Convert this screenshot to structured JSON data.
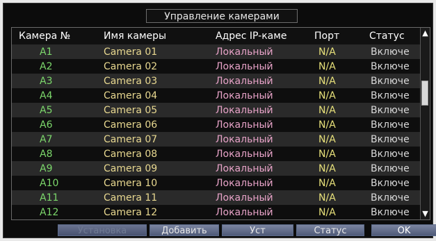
{
  "window": {
    "title": "Управление камерами"
  },
  "table": {
    "headers": {
      "num": "Камера №",
      "name": "Имя камеры",
      "ip": "Адрес IP-каме",
      "port": "Порт",
      "status": "Статус"
    },
    "rows": [
      {
        "num": "A1",
        "name": "Camera 01",
        "ip": "Локальный",
        "port": "N/A",
        "status": "Включе"
      },
      {
        "num": "A2",
        "name": "Camera 02",
        "ip": "Локальный",
        "port": "N/A",
        "status": "Включе"
      },
      {
        "num": "A3",
        "name": "Camera 03",
        "ip": "Локальный",
        "port": "N/A",
        "status": "Включе"
      },
      {
        "num": "A4",
        "name": "Camera 04",
        "ip": "Локальный",
        "port": "N/A",
        "status": "Включе"
      },
      {
        "num": "A5",
        "name": "Camera 05",
        "ip": "Локальный",
        "port": "N/A",
        "status": "Включе"
      },
      {
        "num": "A6",
        "name": "Camera 06",
        "ip": "Локальный",
        "port": "N/A",
        "status": "Включе"
      },
      {
        "num": "A7",
        "name": "Camera 07",
        "ip": "Локальный",
        "port": "N/A",
        "status": "Включе"
      },
      {
        "num": "A8",
        "name": "Camera 08",
        "ip": "Локальный",
        "port": "N/A",
        "status": "Включе"
      },
      {
        "num": "A9",
        "name": "Camera 09",
        "ip": "Локальный",
        "port": "N/A",
        "status": "Включе"
      },
      {
        "num": "A10",
        "name": "Camera 10",
        "ip": "Локальный",
        "port": "N/A",
        "status": "Включе"
      },
      {
        "num": "A11",
        "name": "Camera 11",
        "ip": "Локальный",
        "port": "N/A",
        "status": "Включе"
      },
      {
        "num": "A12",
        "name": "Camera 12",
        "ip": "Локальный",
        "port": "N/A",
        "status": "Включе"
      }
    ]
  },
  "scroll": {
    "up_icon": "chevron-up-icon",
    "down_icon": "chevron-down-icon"
  },
  "buttons": {
    "b1": "Установка",
    "b2": "Добавить",
    "b3": "Уст",
    "b4": "Статус",
    "b5": "OK"
  }
}
